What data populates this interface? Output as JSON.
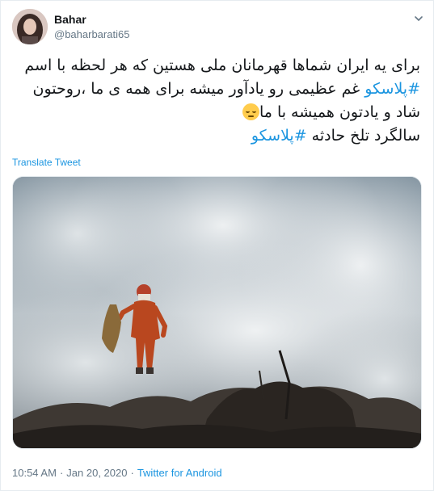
{
  "user": {
    "name": "Bahar",
    "handle": "@baharbarati65"
  },
  "tweet": {
    "lines": [
      {
        "text": "برای یه ایران شماها قهرمانان ملی هستین که هر لحظه با اسم"
      },
      {
        "hashtag": "#پلاسکو",
        "text": " غم عظیمی رو یادآور میشه برای همه ی ما ،روحتون"
      },
      {
        "text": "شاد و یادتون همیشه با ما",
        "emoji": "pensive-face-icon"
      },
      {
        "text": "سالگرد تلخ حادثه ",
        "hashtag": "#پلاسکو"
      }
    ],
    "translate_label": "Translate Tweet",
    "time": "10:54 AM",
    "separator": "·",
    "date": "Jan 20, 2020",
    "source": "Twitter for Android"
  },
  "colors": {
    "link": "#1b95e0",
    "text": "#14171a",
    "muted": "#657786",
    "border": "#e6ecf0"
  },
  "icons": {
    "menu": "chevron-down-icon"
  }
}
